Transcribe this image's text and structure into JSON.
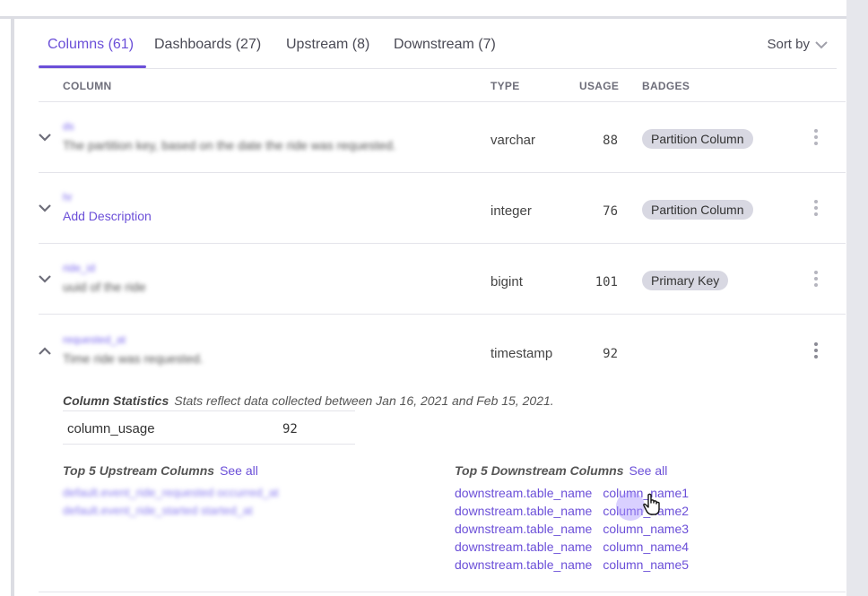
{
  "tabs": [
    {
      "label": "Columns (61)",
      "active": true
    },
    {
      "label": "Dashboards (27)",
      "active": false
    },
    {
      "label": "Upstream (8)",
      "active": false
    },
    {
      "label": "Downstream (7)",
      "active": false
    }
  ],
  "sort": {
    "label": "Sort by"
  },
  "table_headers": {
    "column": "COLUMN",
    "type": "TYPE",
    "usage": "USAGE",
    "badges": "BADGES"
  },
  "rows": [
    {
      "name": "ds",
      "description": "The partition key, based on the date the ride was requested.",
      "type": "varchar",
      "usage": "88",
      "badge": "Partition Column",
      "expanded": false
    },
    {
      "name": "hr",
      "description": "Add Description",
      "type": "integer",
      "usage": "76",
      "badge": "Partition Column",
      "expanded": false
    },
    {
      "name": "ride_id",
      "description": "uuid of the ride",
      "type": "bigint",
      "usage": "101",
      "badge": "Primary Key",
      "expanded": false
    },
    {
      "name": "requested_at",
      "description": "Time ride was requested.",
      "type": "timestamp",
      "usage": "92",
      "badge": "",
      "expanded": true
    }
  ],
  "column_statistics": {
    "title": "Column Statistics",
    "subtitle": "Stats reflect data collected between Jan 16, 2021 and Feb 15, 2021.",
    "stats": [
      {
        "key": "column_usage",
        "value": "92"
      }
    ]
  },
  "upstream": {
    "title": "Top 5 Upstream Columns",
    "see_all": "See all",
    "items": [
      "default.event_ride_requested  occurred_at",
      "default.event_ride_started  started_at"
    ]
  },
  "downstream": {
    "title": "Top 5 Downstream Columns",
    "see_all": "See all",
    "items": [
      {
        "table": "downstream.table_name",
        "column": "column_name1"
      },
      {
        "table": "downstream.table_name",
        "column": "column_name2"
      },
      {
        "table": "downstream.table_name",
        "column": "column_name3"
      },
      {
        "table": "downstream.table_name",
        "column": "column_name4"
      },
      {
        "table": "downstream.table_name",
        "column": "column_name5"
      }
    ]
  },
  "colors": {
    "accent": "#6b4fd8",
    "badge_bg": "#d8d8e2",
    "divider": "#e4e4ea"
  },
  "icons": {
    "expand": "chevron-down-icon",
    "collapse": "chevron-up-icon",
    "menu": "kebab-menu-icon",
    "cursor": "hand-pointer-icon"
  }
}
